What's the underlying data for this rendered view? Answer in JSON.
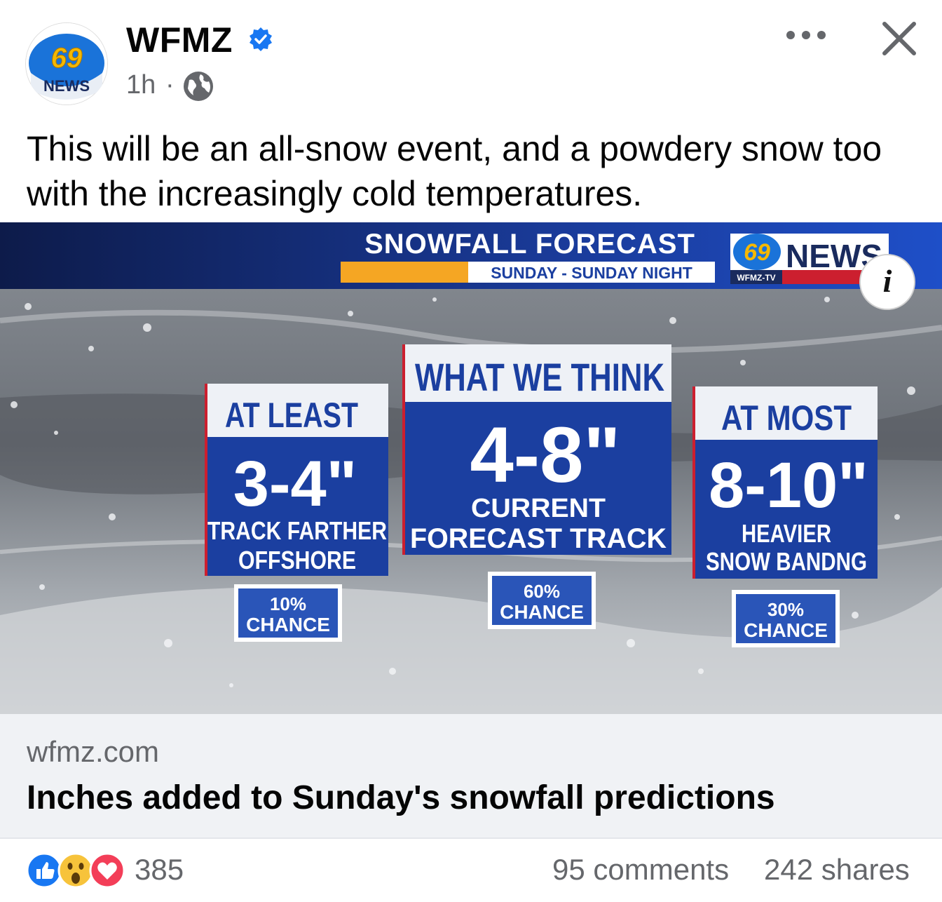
{
  "post": {
    "page_name": "WFMZ",
    "time": "1h",
    "separator": "·",
    "text": "This will be an all-snow event, and a powdery snow too with the increasingly cold temperatures."
  },
  "avatar": {
    "logo_number": "69",
    "logo_word": "NEWS"
  },
  "graphic": {
    "header_title": "SNOWFALL FORECAST",
    "header_subtitle": "SUNDAY - SUNDAY NIGHT",
    "logo_number": "69",
    "logo_word": "NEWS",
    "logo_sub": "WFMZ-TV",
    "info_label": "i",
    "boxes": [
      {
        "heading": "AT LEAST",
        "amount": "3-4\"",
        "line1": "TRACK FARTHER",
        "line2": "OFFSHORE",
        "chance_pct": "10%",
        "chance_word": "CHANCE"
      },
      {
        "heading": "WHAT WE THINK",
        "amount": "4-8\"",
        "line1": "CURRENT",
        "line2": "FORECAST TRACK",
        "chance_pct": "60%",
        "chance_word": "CHANCE"
      },
      {
        "heading": "AT MOST",
        "amount": "8-10\"",
        "line1": "HEAVIER",
        "line2": "SNOW BANDNG",
        "chance_pct": "30%",
        "chance_word": "CHANCE"
      }
    ]
  },
  "link": {
    "domain": "wfmz.com",
    "title": "Inches added to Sunday's snowfall predictions"
  },
  "footer": {
    "reaction_count": "385",
    "comments": "95 comments",
    "shares": "242 shares",
    "reaction_icons": [
      "like-icon",
      "wow-icon",
      "love-icon"
    ]
  },
  "colors": {
    "brand_blue": "#1b3fa0",
    "verified_blue": "#1877f2",
    "orange": "#f5a623",
    "text_secondary": "#65676b"
  }
}
